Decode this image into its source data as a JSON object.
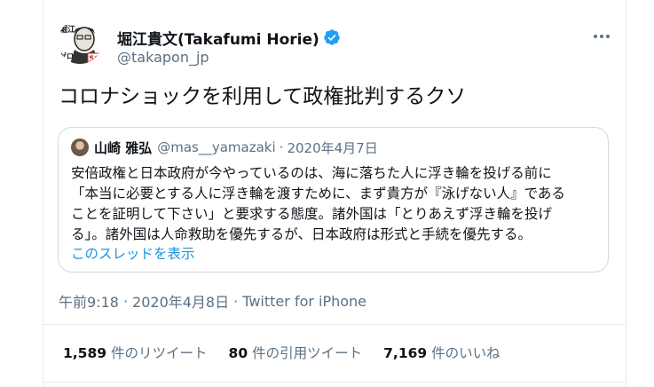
{
  "tweet": {
    "author": {
      "display_name": "堀江貴文(Takafumi Horie)",
      "handle": "@takapon_jp"
    },
    "more_icon": "more-horizontal-icon",
    "text": "コロナショックを利用して政権批判するクソ",
    "quoted_tweet": {
      "author_name": "山崎 雅弘",
      "author_handle": "@mas__yamazaki",
      "separator": "·",
      "date": "2020年4月7日",
      "body_lines": [
        "安倍政権と日本政府が今やっているのは、海に落ちた人に浮き輪を投げる前に",
        "「本当に必要とする人に浮き輪を渡すために、まず貴方が『泳げない人』である",
        "ことを証明して下さい」と要求する態度。諸外国は「とりあえず浮き輪を投げ",
        "る」。諸外国は人命救助を優先するが、日本政府は形式と手続を優先する。"
      ],
      "show_thread_label": "このスレッドを表示"
    },
    "meta": {
      "time": "午前9:18",
      "separator": "·",
      "date": "2020年4月8日",
      "source": "Twitter for iPhone"
    },
    "stats": [
      {
        "count": "1,589",
        "label": "件のリツイート"
      },
      {
        "count": "80",
        "label": "件の引用ツイート"
      },
      {
        "count": "7,169",
        "label": "件のいいね"
      }
    ],
    "colors": {
      "accent": "#1b95e0",
      "verified": "#1da1f2",
      "secondary_text": "#5b7083",
      "border": "#e6ecf0"
    },
    "avatar_text": {
      "book_title_top": "堀江",
      "book_title_bottom": "ゼロ",
      "number": "50"
    }
  }
}
